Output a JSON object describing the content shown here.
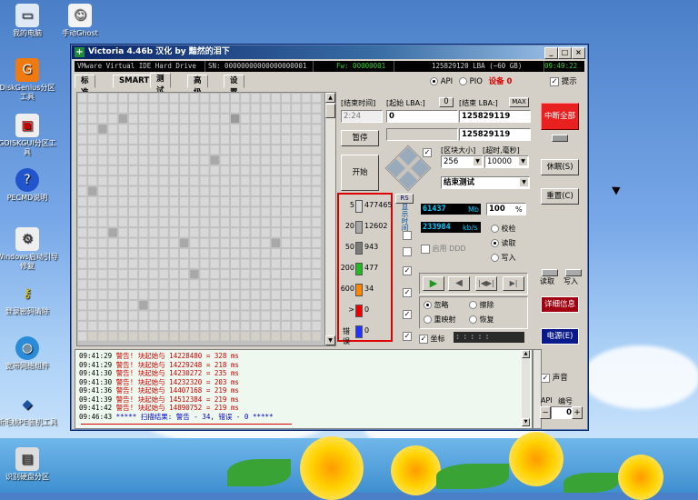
{
  "desktop": {
    "icons": [
      {
        "label": "我的电脑",
        "icon": "computer-icon"
      },
      {
        "label": "手动Ghost",
        "icon": "ghost-icon"
      },
      {
        "label": "DiskGenius分区工具",
        "icon": "diskgenius-icon"
      },
      {
        "label": "GDISKGUI分区工具",
        "icon": "gdisk-icon"
      },
      {
        "label": "PECMD说明",
        "icon": "help-icon"
      },
      {
        "label": "Windows启动引导修复",
        "icon": "boot-repair-icon"
      },
      {
        "label": "登录密码清除",
        "icon": "key-icon"
      },
      {
        "label": "宽带网络组件",
        "icon": "network-icon"
      },
      {
        "label": "新毛桃PE装机工具",
        "icon": "installer-icon"
      },
      {
        "label": "识别硬盘分区",
        "icon": "disk-icon"
      }
    ]
  },
  "window": {
    "title": "Victoria 4.46b 汉化 by 黯然的泪下",
    "controls": {
      "min": "_",
      "max": "□",
      "close": "×"
    },
    "infobar": {
      "model": "VMware Virtual IDE Hard Drive",
      "serial": "SN: 00000000000000000001",
      "firmware": "Fw: 00000001",
      "lba": "125829120 LBA (~60 GB)",
      "time": "09:49:22"
    },
    "tabs": [
      "标准",
      "SMART",
      "测试",
      "高级",
      "设置"
    ],
    "mode": {
      "api_label": "API",
      "pio_label": "PIO",
      "device_label": "设备 0"
    },
    "hint_label": "提示"
  },
  "test": {
    "end_time_label": "[结束时间]",
    "end_time_value": "2:24",
    "start_lba_label": "[起始 LBA:]",
    "start_lba_btn": "0",
    "start_lba_value": "0",
    "end_lba_label": "[结束 LBA:]",
    "end_lba_max": "MAX",
    "end_lba_value": "125829119",
    "current_lba_value": "125829119",
    "pause_label": "暂停",
    "start_label": "开始",
    "block_size_label": "[区块大小]",
    "timeout_label": "[超时,毫秒]",
    "block_size_value": "256",
    "timeout_value": "10000",
    "action_value": "结束测试",
    "rs_label": "RS",
    "vertical_label": "显示时间:",
    "mb_value": "61437",
    "mb_unit": "Mb",
    "percent_value": "100",
    "percent_unit": "%",
    "speed_value": "233984",
    "speed_unit": "kb/s",
    "verify_label": "校检",
    "read_label": "读取",
    "write_label": "写入",
    "ddd_label": "启用 DDD",
    "ignore_label": "忽略",
    "erase_label": "擦除",
    "remap_label": "重映射",
    "restore_label": "恢复",
    "coord_label": "坐标",
    "coord_value": ":::::"
  },
  "legend": [
    {
      "label": "5",
      "count": "477465",
      "color": "#d8d8d8"
    },
    {
      "label": "20",
      "count": "12602",
      "color": "#a8a8a8"
    },
    {
      "label": "50",
      "count": "943",
      "color": "#7a7a7a"
    },
    {
      "label": "200",
      "count": "477",
      "color": "#22bb22"
    },
    {
      "label": "600",
      "count": "34",
      "color": "#ff8800"
    },
    {
      "label": ">",
      "count": "0",
      "color": "#ee0000"
    },
    {
      "label": "错误",
      "count": "0",
      "color": "#2233ff"
    }
  ],
  "sidebar": {
    "interrupt_label": "中断全部",
    "sleep_label": "休眠(S)",
    "reset_label": "重置(C)",
    "read_label": "读取",
    "write_label": "写入",
    "details_label": "详细信息",
    "power_label": "电源(E)",
    "sound_label": "声音",
    "api_label": "API",
    "number_label": "编号",
    "number_value": "0"
  },
  "log": [
    {
      "time": "09:41:29",
      "text": "警告! 块起始与 14228480 = 328 ms",
      "color": "#cc0000"
    },
    {
      "time": "09:41:29",
      "text": "警告! 块起始与 14229248 = 218 ms",
      "color": "#cc0000"
    },
    {
      "time": "09:41:30",
      "text": "警告! 块起始与 14230272 = 235 ms",
      "color": "#cc0000"
    },
    {
      "time": "09:41:30",
      "text": "警告! 块起始与 14232320 = 203 ms",
      "color": "#cc0000"
    },
    {
      "time": "09:41:36",
      "text": "警告! 块起始与 14407168 = 219 ms",
      "color": "#cc0000"
    },
    {
      "time": "09:41:39",
      "text": "警告! 块起始与 14512384 = 219 ms",
      "color": "#cc0000"
    },
    {
      "time": "09:41:42",
      "text": "警告! 块起始与 14890752 = 219 ms",
      "color": "#cc0000"
    },
    {
      "time": "09:46:43",
      "text": "***** 扫描结果: 警告 - 34, 错误 - 0 *****",
      "color": "#0000cc"
    }
  ]
}
